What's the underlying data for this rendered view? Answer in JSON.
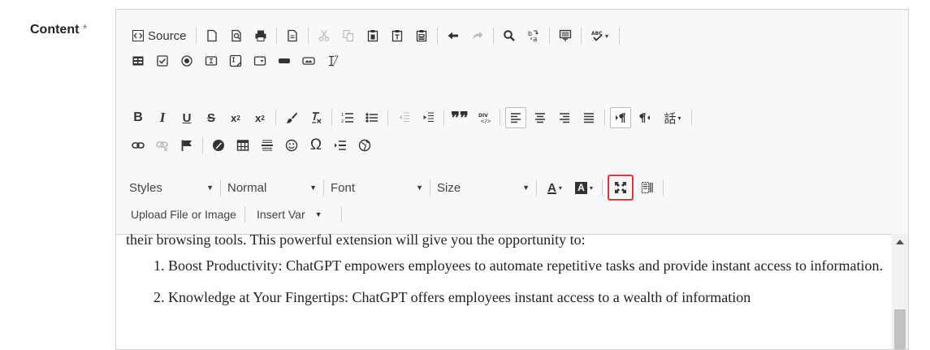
{
  "field": {
    "label": "Content",
    "required_mark": "*"
  },
  "toolbar": {
    "source_label": "Source",
    "styles": {
      "label": "Styles"
    },
    "format": {
      "label": "Normal"
    },
    "font": {
      "label": "Font"
    },
    "size": {
      "label": "Size"
    },
    "upload_label": "Upload File or Image",
    "insert_var_label": "Insert Var"
  },
  "content": {
    "intro": "their browsing tools. This powerful extension will give you the opportunity to:",
    "items": [
      "Boost Productivity: ChatGPT empowers employees to automate repetitive tasks and provide instant access to information.",
      "Knowledge at Your Fingertips: ChatGPT offers employees instant access to a wealth of information"
    ]
  },
  "colors": {
    "highlight": "#d9383a",
    "toolbar_bg": "#f8f8f8"
  }
}
